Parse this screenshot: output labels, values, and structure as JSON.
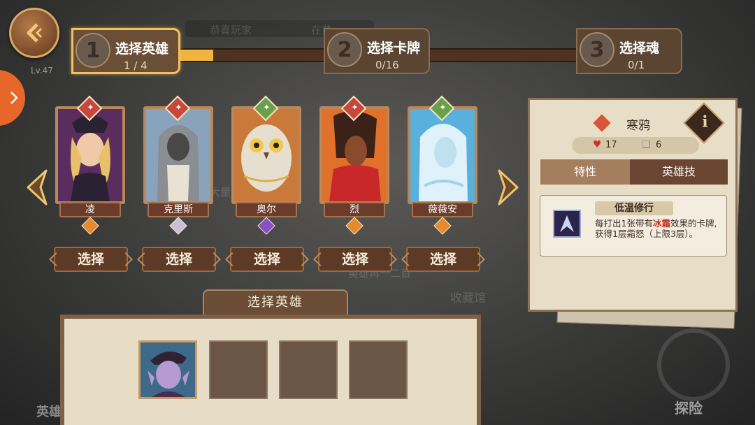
{
  "background": {
    "ghost_texts": [
      "恭喜玩家",
      "在黄",
      "大量",
      "英雄再一二首",
      "收藏馆"
    ],
    "level": "Lv.47",
    "explore_label": "探险",
    "bottom_left_label": "英雄"
  },
  "steps": [
    {
      "num": "1",
      "title": "选择英雄",
      "count": "1 / 4",
      "active": true
    },
    {
      "num": "2",
      "title": "选择卡牌",
      "count": "0/16",
      "active": false
    },
    {
      "num": "3",
      "title": "选择魂",
      "count": "0/1",
      "active": false
    }
  ],
  "heroes": [
    {
      "name": "凌",
      "select_label": "选择",
      "class_color": "#c9473a",
      "gem_color": "#e58a2e"
    },
    {
      "name": "克里斯",
      "select_label": "选择",
      "class_color": "#c9473a",
      "gem_color": "#c8bfd8"
    },
    {
      "name": "奥尔",
      "select_label": "选择",
      "class_color": "#6aa04a",
      "gem_color": "#8a4fc4"
    },
    {
      "name": "烈",
      "select_label": "选择",
      "class_color": "#c9473a",
      "gem_color": "#e58a2e"
    },
    {
      "name": "薇薇安",
      "select_label": "选择",
      "class_color": "#6aa04a",
      "gem_color": "#e58a2e"
    }
  ],
  "panel": {
    "title": "选择英雄"
  },
  "detail": {
    "name": "寒鸦",
    "info_icon": "i",
    "hp": "17",
    "cards": "6",
    "tabs": [
      "特性",
      "英雄技"
    ],
    "skill": {
      "title": "低温修行",
      "desc_prefix": "每打出1张带有",
      "desc_highlight": "冰霜",
      "desc_suffix": "效果的卡牌,获得1层霜怒（上限3层）。"
    }
  },
  "colors": {
    "accent": "#f3c25b",
    "progress_fill": "#f0b53e",
    "highlight": "#c32d1c"
  }
}
